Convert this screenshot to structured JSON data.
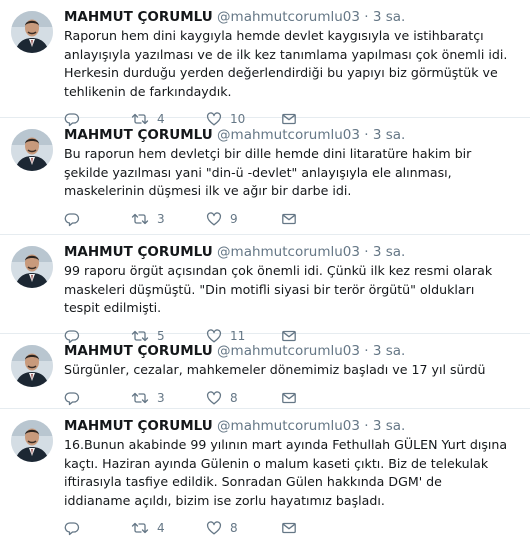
{
  "colors": {
    "text": "#14171a",
    "secondary": "#657786",
    "divider": "#e6ecf0"
  },
  "icons": {
    "reply": "reply-icon",
    "retweet": "retweet-icon",
    "like": "like-icon",
    "message": "direct-message-icon"
  },
  "tweets": [
    {
      "name": "MAHMUT ÇORUMLU",
      "handle": "@mahmutcorumlu03",
      "dot": "·",
      "time": "3 sa.",
      "text": "Raporun hem dini kaygıyla hemde devlet kaygısıyla ve istihbaratçı anlayışıyla yazılması  ve de ilk kez tanımlama yapılması çok önemli idi. Herkesin durduğu yerden değerlendirdiği bu yapıyı biz görmüştük ve tehlikenin de farkındaydık.",
      "retweets": "4",
      "likes": "10"
    },
    {
      "name": "MAHMUT ÇORUMLU",
      "handle": "@mahmutcorumlu03",
      "dot": "·",
      "time": "3 sa.",
      "text": "Bu raporun hem devletçi bir dille hemde dini litaratüre hakim bir şekilde yazılması yani \"din-ü -devlet\" anlayışıyla ele alınması, maskelerinin düşmesi ilk ve ağır bir darbe idi.",
      "retweets": "3",
      "likes": "9"
    },
    {
      "name": "MAHMUT ÇORUMLU",
      "handle": "@mahmutcorumlu03",
      "dot": "·",
      "time": "3 sa.",
      "text": "99 raporu örgüt açısından çok önemli idi. Çünkü ilk kez resmi olarak maskeleri düşmüştü. \"Din motifli siyasi bir terör örgütü\" oldukları tespit edilmişti.",
      "retweets": "5",
      "likes": "11"
    },
    {
      "name": "MAHMUT ÇORUMLU",
      "handle": "@mahmutcorumlu03",
      "dot": "·",
      "time": "3 sa.",
      "text": "Sürgünler, cezalar, mahkemeler dönemimiz başladı ve 17 yıl sürdü",
      "retweets": "3",
      "likes": "8"
    },
    {
      "name": "MAHMUT ÇORUMLU",
      "handle": "@mahmutcorumlu03",
      "dot": "·",
      "time": "3 sa.",
      "text": "16.Bunun akabinde 99 yılının mart ayında Fethullah GÜLEN Yurt dışına kaçtı. Haziran ayında Gülenin o malum kaseti çıktı. Biz de telekulak iftirasıyla tasfiye edildik. Sonradan Gülen hakkında DGM' de iddianame açıldı, bizim ise zorlu hayatımız başladı.",
      "retweets": "4",
      "likes": "8"
    }
  ]
}
